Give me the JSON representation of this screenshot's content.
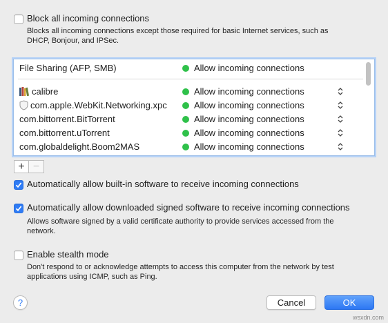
{
  "block_all": {
    "checked": false,
    "label": "Block all incoming connections",
    "desc1": "Blocks all incoming connections except those required for basic Internet services,  such as",
    "desc2": "DHCP, Bonjour, and IPSec."
  },
  "app_list": {
    "header": {
      "name": "File Sharing (AFP, SMB)",
      "status": "Allow incoming connections"
    },
    "rows": [
      {
        "name": "calibre",
        "icon": "calibre-books-icon",
        "status": "Allow incoming connections"
      },
      {
        "name": "com.apple.WebKit.Networking.xpc",
        "icon": "shield-icon",
        "status": "Allow incoming connections"
      },
      {
        "name": "com.bittorrent.BitTorrent",
        "status": "Allow incoming connections"
      },
      {
        "name": "com.bittorrent.uTorrent",
        "status": "Allow incoming connections"
      },
      {
        "name": "com.globaldelight.Boom2MAS",
        "status": "Allow incoming connections"
      }
    ],
    "status_color": "#2fc14a"
  },
  "add_button": "+",
  "remove_button": "−",
  "auto_builtin": {
    "checked": true,
    "label": "Automatically allow built-in software to receive incoming connections"
  },
  "auto_signed": {
    "checked": true,
    "label": "Automatically allow downloaded signed software to receive incoming connections",
    "desc1": "Allows software signed by a valid certificate authority to provide services accessed from the",
    "desc2": "network."
  },
  "stealth": {
    "checked": false,
    "label": "Enable stealth mode",
    "desc1": "Don't respond to or acknowledge attempts to access this computer from the network by test",
    "desc2": "applications using ICMP, such as Ping."
  },
  "help_button": "?",
  "cancel_button": "Cancel",
  "ok_button": "OK",
  "watermark": "wsxdn.com",
  "accent_color": "#2f7cf6"
}
